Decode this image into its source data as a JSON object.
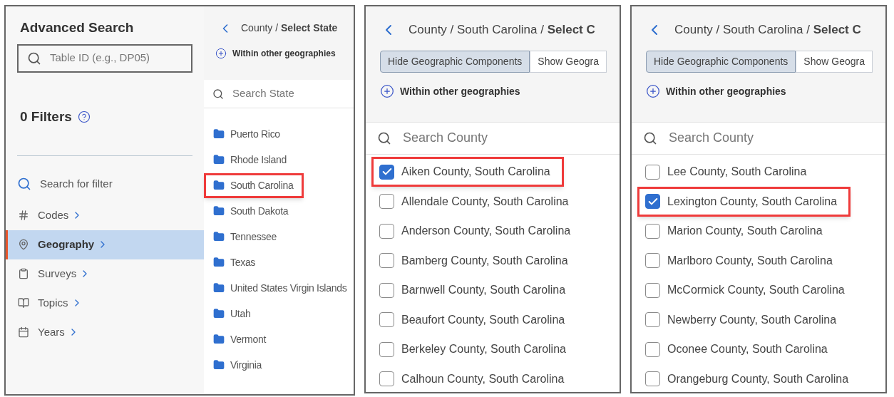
{
  "advanced_search": {
    "title": "Advanced Search",
    "search": {
      "placeholder": "Table ID (e.g., DP05)"
    },
    "filters_title": "0 Filters",
    "filter_search": "Search for filter",
    "nav": [
      {
        "kind": "codes",
        "label": "Codes",
        "selected": false
      },
      {
        "kind": "geography",
        "label": "Geography",
        "selected": true
      },
      {
        "kind": "surveys",
        "label": "Surveys",
        "selected": false
      },
      {
        "kind": "topics",
        "label": "Topics",
        "selected": false
      },
      {
        "kind": "years",
        "label": "Years",
        "selected": false
      }
    ]
  },
  "state_picker": {
    "breadcrumb": "County / **Select State**",
    "within": "Within other geographies",
    "search": {
      "placeholder": "Search State"
    },
    "states": [
      {
        "label": "Puerto Rico",
        "highlighted": false
      },
      {
        "label": "Rhode Island",
        "highlighted": false
      },
      {
        "label": "South Carolina",
        "highlighted": true
      },
      {
        "label": "South Dakota",
        "highlighted": false
      },
      {
        "label": "Tennessee",
        "highlighted": false
      },
      {
        "label": "Texas",
        "highlighted": false
      },
      {
        "label": "United States Virgin Islands",
        "highlighted": false
      },
      {
        "label": "Utah",
        "highlighted": false
      },
      {
        "label": "Vermont",
        "highlighted": false
      },
      {
        "label": "Virginia",
        "highlighted": false
      }
    ]
  },
  "county_pickers": [
    {
      "breadcrumb": "County / South Carolina / **Select C**",
      "toggles": [
        {
          "label": "Hide Geographic Components",
          "selected": true
        },
        {
          "label": "Show Geogra",
          "selected": false
        }
      ],
      "within": "Within other geographies",
      "search": {
        "placeholder": "Search County"
      },
      "counties": [
        {
          "label": "Aiken County, South Carolina",
          "checked": true,
          "highlighted": true
        },
        {
          "label": "Allendale County, South Carolina",
          "checked": false,
          "highlighted": false
        },
        {
          "label": "Anderson County, South Carolina",
          "checked": false,
          "highlighted": false
        },
        {
          "label": "Bamberg County, South Carolina",
          "checked": false,
          "highlighted": false
        },
        {
          "label": "Barnwell County, South Carolina",
          "checked": false,
          "highlighted": false
        },
        {
          "label": "Beaufort County, South Carolina",
          "checked": false,
          "highlighted": false
        },
        {
          "label": "Berkeley County, South Carolina",
          "checked": false,
          "highlighted": false
        },
        {
          "label": "Calhoun County, South Carolina",
          "checked": false,
          "highlighted": false
        }
      ]
    },
    {
      "breadcrumb": "County / South Carolina / **Select C**",
      "toggles": [
        {
          "label": "Hide Geographic Components",
          "selected": true
        },
        {
          "label": "Show Geogra",
          "selected": false
        }
      ],
      "within": "Within other geographies",
      "search": {
        "placeholder": "Search County"
      },
      "counties": [
        {
          "label": "Lee County, South Carolina",
          "checked": false,
          "highlighted": false
        },
        {
          "label": "Lexington County, South Carolina",
          "checked": true,
          "highlighted": true
        },
        {
          "label": "Marion County, South Carolina",
          "checked": false,
          "highlighted": false
        },
        {
          "label": "Marlboro County, South Carolina",
          "checked": false,
          "highlighted": false
        },
        {
          "label": "McCormick County, South Carolina",
          "checked": false,
          "highlighted": false
        },
        {
          "label": "Newberry County, South Carolina",
          "checked": false,
          "highlighted": false
        },
        {
          "label": "Oconee County, South Carolina",
          "checked": false,
          "highlighted": false
        },
        {
          "label": "Orangeburg County, South Carolina",
          "checked": false,
          "highlighted": false
        }
      ]
    }
  ]
}
